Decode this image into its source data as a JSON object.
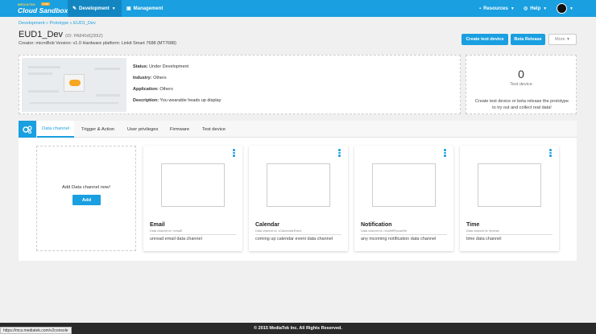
{
  "topbar": {
    "logo_top": "MEDIATEK",
    "logo_beta": "beta",
    "logo_main": "Cloud Sandbox",
    "nav_development": "Development",
    "nav_management": "Management",
    "nav_resources": "Resources",
    "nav_help": "Help"
  },
  "breadcrumb": "Development » Prototype » EUD1_Dev",
  "prototype": {
    "name": "EUD1_Dev",
    "id": "(ID: PA840dQ30IZ)",
    "meta": "Creator: microBob    Version: v1.0    Hardware platform: Linkit Smart 7688 (MT7688)"
  },
  "actions": {
    "create_test_device": "Create test device",
    "beta_release": "Beta Release",
    "more": "More"
  },
  "info": {
    "status_label": "Status:",
    "status_value": "Under Development",
    "industry_label": "Industry:",
    "industry_value": "Others",
    "application_label": "Application:",
    "application_value": "Others",
    "description_label": "Description:",
    "description_value": "You wearable heads up display"
  },
  "test_devices": {
    "count": "0",
    "label": "Test device",
    "hint": "Create test device or beta release the prototype to try out and collect real data!"
  },
  "tabs": [
    "Data channel",
    "Trigger & Action",
    "User privileges",
    "Firmware",
    "Test device"
  ],
  "add_channel": {
    "text": "Add Data channel now!",
    "button": "Add"
  },
  "channels": [
    {
      "name": "Email",
      "id": "Data channel id: mmaiE",
      "description": "unread email data channel"
    },
    {
      "name": "Calendar",
      "id": "Data channel id: cCalcendarEvent",
      "description": "coming up calendar event data channel"
    },
    {
      "name": "Notification",
      "id": "Data channel id: nmotifiPhcuseNh",
      "description": "any incoming notification data channel"
    },
    {
      "name": "Time",
      "id": "Data channel id: timmse",
      "description": "time data channel"
    }
  ],
  "footer": "© 2015 MediaTek Inc. All Rights Reserved.",
  "status_url": "https://mcs.mediatek.com/v2console"
}
